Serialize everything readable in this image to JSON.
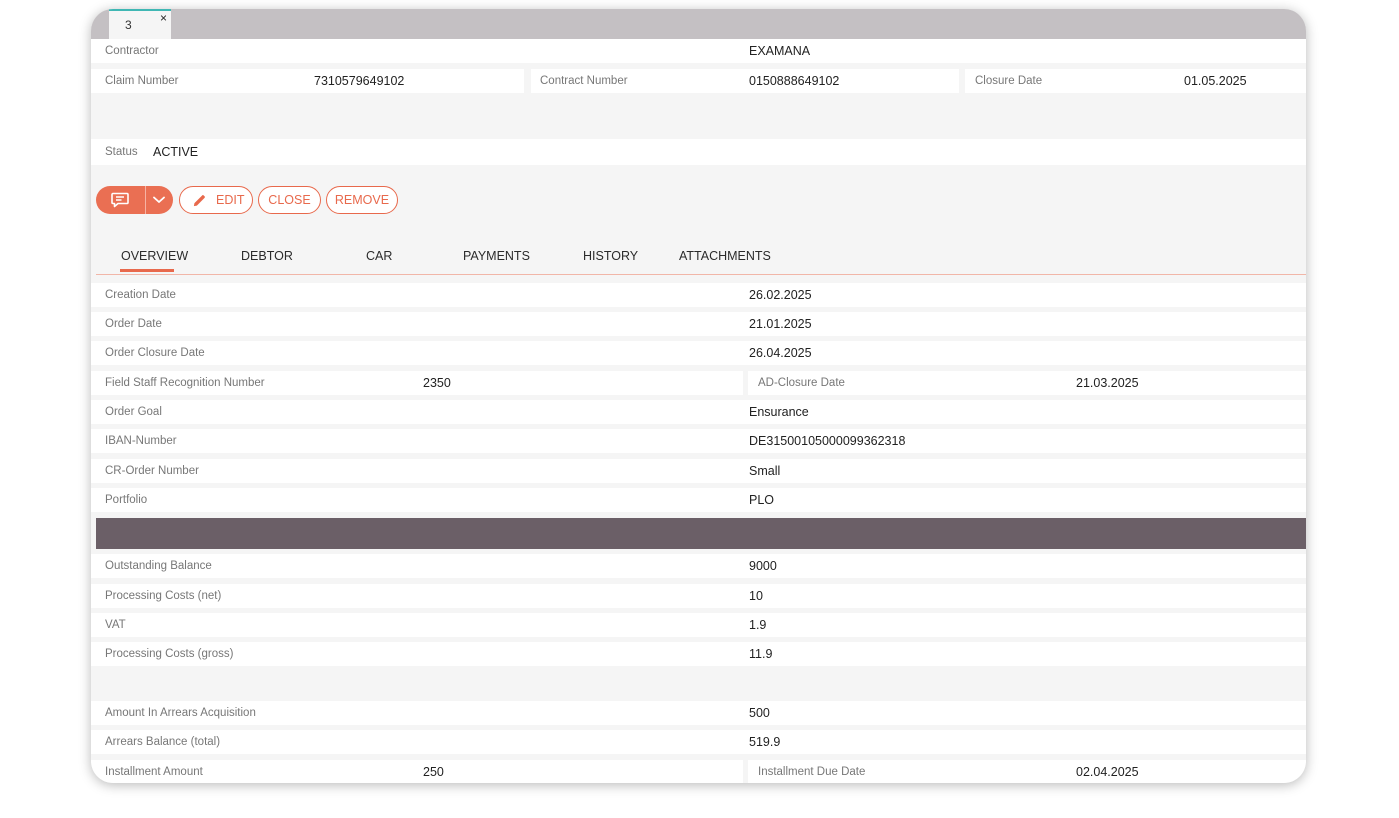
{
  "tab": {
    "label": "3",
    "close": "×"
  },
  "header": {
    "contractor": {
      "label": "Contractor",
      "value": "EXAMANA"
    },
    "claim_number": {
      "label": "Claim Number",
      "value": "7310579649102"
    },
    "contract_number": {
      "label": "Contract Number",
      "value": "0150888649102"
    },
    "closure_date": {
      "label": "Closure Date",
      "value": "01.05.2025"
    },
    "status": {
      "label": "Status",
      "value": "ACTIVE"
    }
  },
  "actions": {
    "edit": "EDIT",
    "close": "CLOSE",
    "remove": "REMOVE"
  },
  "tabs": [
    "OVERVIEW",
    "DEBTOR",
    "CAR",
    "PAYMENTS",
    "HISTORY",
    "ATTACHMENTS"
  ],
  "overview": {
    "creation_date": {
      "label": "Creation Date",
      "value": "26.02.2025"
    },
    "order_date": {
      "label": "Order Date",
      "value": "21.01.2025"
    },
    "order_closure_date": {
      "label": "Order Closure Date",
      "value": "26.04.2025"
    },
    "field_staff": {
      "label": "Field Staff Recognition Number",
      "value": "2350"
    },
    "ad_closure": {
      "label": "AD-Closure Date",
      "value": "21.03.2025"
    },
    "order_goal": {
      "label": "Order Goal",
      "value": "Ensurance"
    },
    "iban": {
      "label": "IBAN-Number",
      "value": "DE31500105000099362318"
    },
    "cr_order": {
      "label": "CR-Order Number",
      "value": "Small"
    },
    "portfolio": {
      "label": "Portfolio",
      "value": "PLO"
    }
  },
  "financials": {
    "outstanding_balance": {
      "label": "Outstanding Balance",
      "value": "9000"
    },
    "processing_net": {
      "label": "Processing Costs (net)",
      "value": "10"
    },
    "vat": {
      "label": "VAT",
      "value": "1.9"
    },
    "processing_gross": {
      "label": "Processing Costs (gross)",
      "value": "11.9"
    },
    "arrears_acq": {
      "label": "Amount In Arrears Acquisition",
      "value": "500"
    },
    "arrears_total": {
      "label": "Arrears Balance (total)",
      "value": "519.9"
    },
    "installment_amount": {
      "label": "Installment Amount",
      "value": "250"
    },
    "installment_due": {
      "label": "Installment Due Date",
      "value": "02.04.2025"
    }
  },
  "colors": {
    "accent": "#e8694c",
    "section_bar": "#6b5f67",
    "tab_bar": "#c4c0c3",
    "tab_indicator": "#3fb7b4"
  },
  "icons": {
    "comment": "comment-icon",
    "dropdown": "chevron-down-icon",
    "edit": "pencil-icon"
  }
}
